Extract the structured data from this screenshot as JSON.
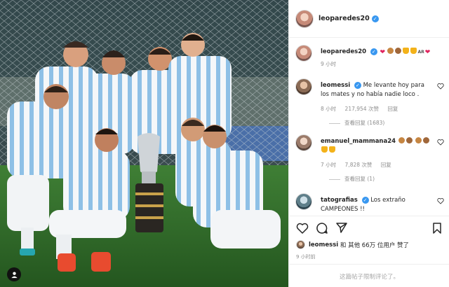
{
  "post": {
    "author": "leoparedes20",
    "caption_username": "leoparedes20",
    "caption_time": "9 小时"
  },
  "comments": [
    {
      "username": "leomessi",
      "text": "Me levante hoy para los mates y no había nadie loco .",
      "time": "8 小时",
      "likes": "217,954 次赞",
      "reply": "回复",
      "view_replies": "查看回复 (1683)"
    },
    {
      "username": "emanuel_mammana24",
      "text": "",
      "time": "7 小时",
      "likes": "7,828 次赞",
      "reply": "回复",
      "view_replies": "查看回复 (1)"
    },
    {
      "username": "tatografias",
      "text": "Los extraño CAMPEONES !!",
      "time": "",
      "likes": "",
      "reply": "",
      "view_replies": ""
    }
  ],
  "actions": {
    "like_icon": "heart-icon",
    "comment_icon": "comment-icon",
    "share_icon": "send-icon",
    "save_icon": "bookmark-icon"
  },
  "likes_line": {
    "username": "leomessi",
    "text": "和 其他 66万 位用户 赞了"
  },
  "time_ago": "9 小时前",
  "comment_placeholder": "这篇帖子限制评论了。",
  "colors": {
    "verified": "#3897f0",
    "heart_red": "#e0245e",
    "muted": "#8e8e8e",
    "jersey_blue": "#75aadb",
    "pitch_green": "#2f6b2c"
  }
}
